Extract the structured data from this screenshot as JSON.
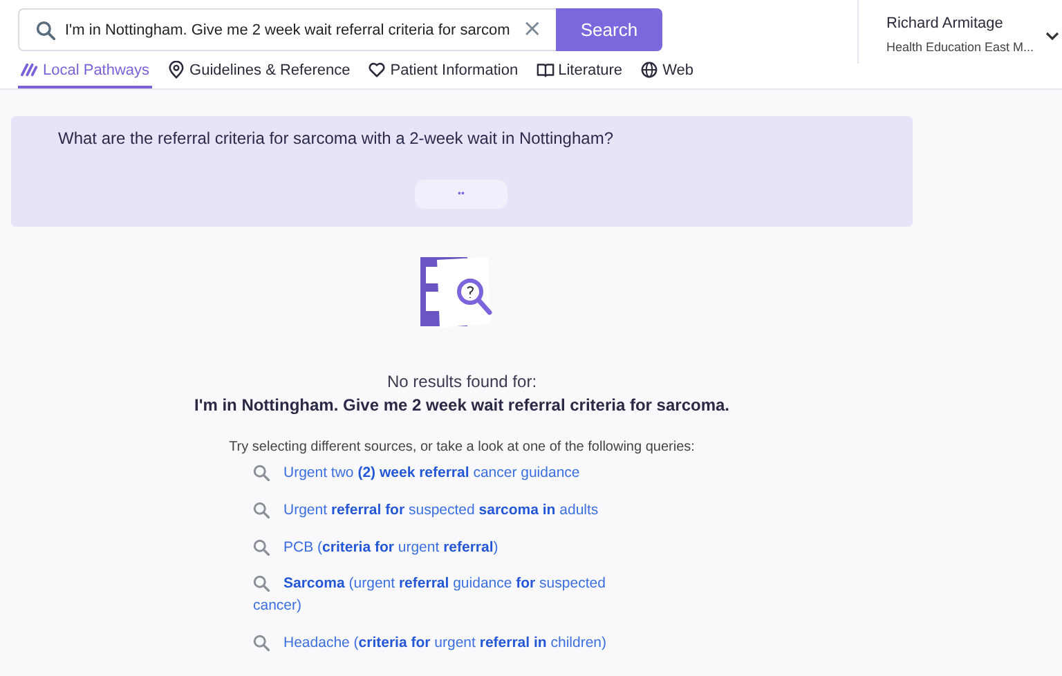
{
  "search": {
    "value": "I'm in Nottingham. Give me 2 week wait referral criteria for sarcom",
    "clear": "×",
    "button": "Search"
  },
  "user": {
    "name": "Richard Armitage",
    "organisation": "Health Education East M..."
  },
  "tabs": [
    {
      "label": "Local Pathways",
      "selected": true
    },
    {
      "label": "Guidelines & Reference",
      "selected": false
    },
    {
      "label": "Patient Information",
      "selected": false
    },
    {
      "label": "Literature",
      "selected": false
    },
    {
      "label": "Web",
      "selected": false
    }
  ],
  "question": {
    "text": "What are the referral criteria for sarcoma with a 2-week wait in Nottingham?",
    "more": "••"
  },
  "no_results": {
    "heading": "No results found for:",
    "query": "I'm in Nottingham. Give me 2 week wait referral criteria for sarcoma.",
    "hint": "Try selecting different sources, or take a look at one of the following queries:"
  },
  "suggestions": [
    "Urgent two **(2)** **week** **referral** cancer guidance",
    "Urgent **referral** **for** suspected **sarcoma** **in** adults",
    "PCB (**criteria** **for** urgent **referral**)",
    "**Sarcoma** (urgent **referral** guidance **for** suspected cancer)",
    "Headache (**criteria** **for** urgent **referral** **in** children)"
  ]
}
